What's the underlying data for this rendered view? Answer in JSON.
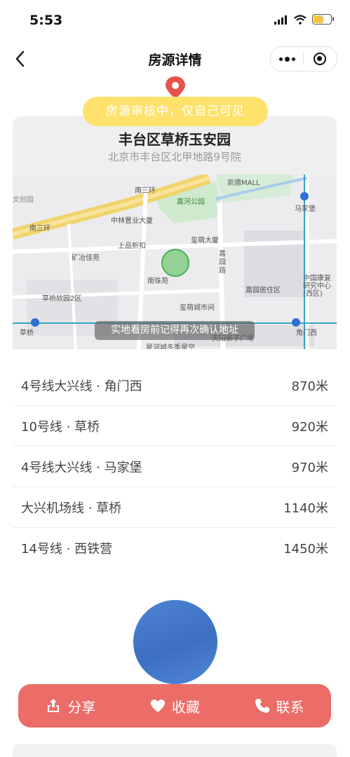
{
  "status_bar": {
    "time": "5:53"
  },
  "nav": {
    "title": "房源详情"
  },
  "review_notice": "房源审核中，仅自己可见",
  "address": {
    "community": "丰台区草桥玉安园",
    "full_address": "北京市丰台区北甲地路9号院"
  },
  "map": {
    "tip": "实地看房前记得再次确认地址",
    "labels": {
      "nansanhuan_top": "南三环",
      "nansanhuan_left": "南三环",
      "kaide_mall": "凯德MALL",
      "jiahe_park": "嘉河公园",
      "majiapu": "马家堡",
      "zhonglin": "中林置业大厦",
      "shangpin": "上品折扣",
      "xihao_tower": "玺萌大厦",
      "kuangye": "矿冶佳苑",
      "nanzhuyuan": "南珠苑",
      "jiayuan_road": "嘉园路",
      "jiayuan_juzhu": "嘉园居住区",
      "caoqiao_xinyuan": "草桥欣园2区",
      "xihao_city": "玺萌城市间",
      "zhongguo_kangfu": "中国康复研究中心(西区)",
      "caoqiao_station": "草桥",
      "jiaomenxi_station": "角门西",
      "tianyang": "天阳亲子广场",
      "xinghe": "星河城冬季星空",
      "wenchuang": "文创园"
    }
  },
  "metro": [
    {
      "line": "4号线大兴线 · 角门西",
      "distance": "870米"
    },
    {
      "line": "10号线 · 草桥",
      "distance": "920米"
    },
    {
      "line": "4号线大兴线 · 马家堡",
      "distance": "970米"
    },
    {
      "line": "大兴机场线 · 草桥",
      "distance": "1140米"
    },
    {
      "line": "14号线 · 西铁营",
      "distance": "1450米"
    }
  ],
  "actions": {
    "share": "分享",
    "favorite": "收藏",
    "contact": "联系"
  },
  "colors": {
    "accent": "#ec6d68",
    "badge": "#ffe26b",
    "pin": "#e5534b"
  },
  "icons": [
    "back-icon",
    "more-icon",
    "close-mini-icon",
    "location-pin-icon",
    "share-icon",
    "heart-icon",
    "phone-icon"
  ]
}
